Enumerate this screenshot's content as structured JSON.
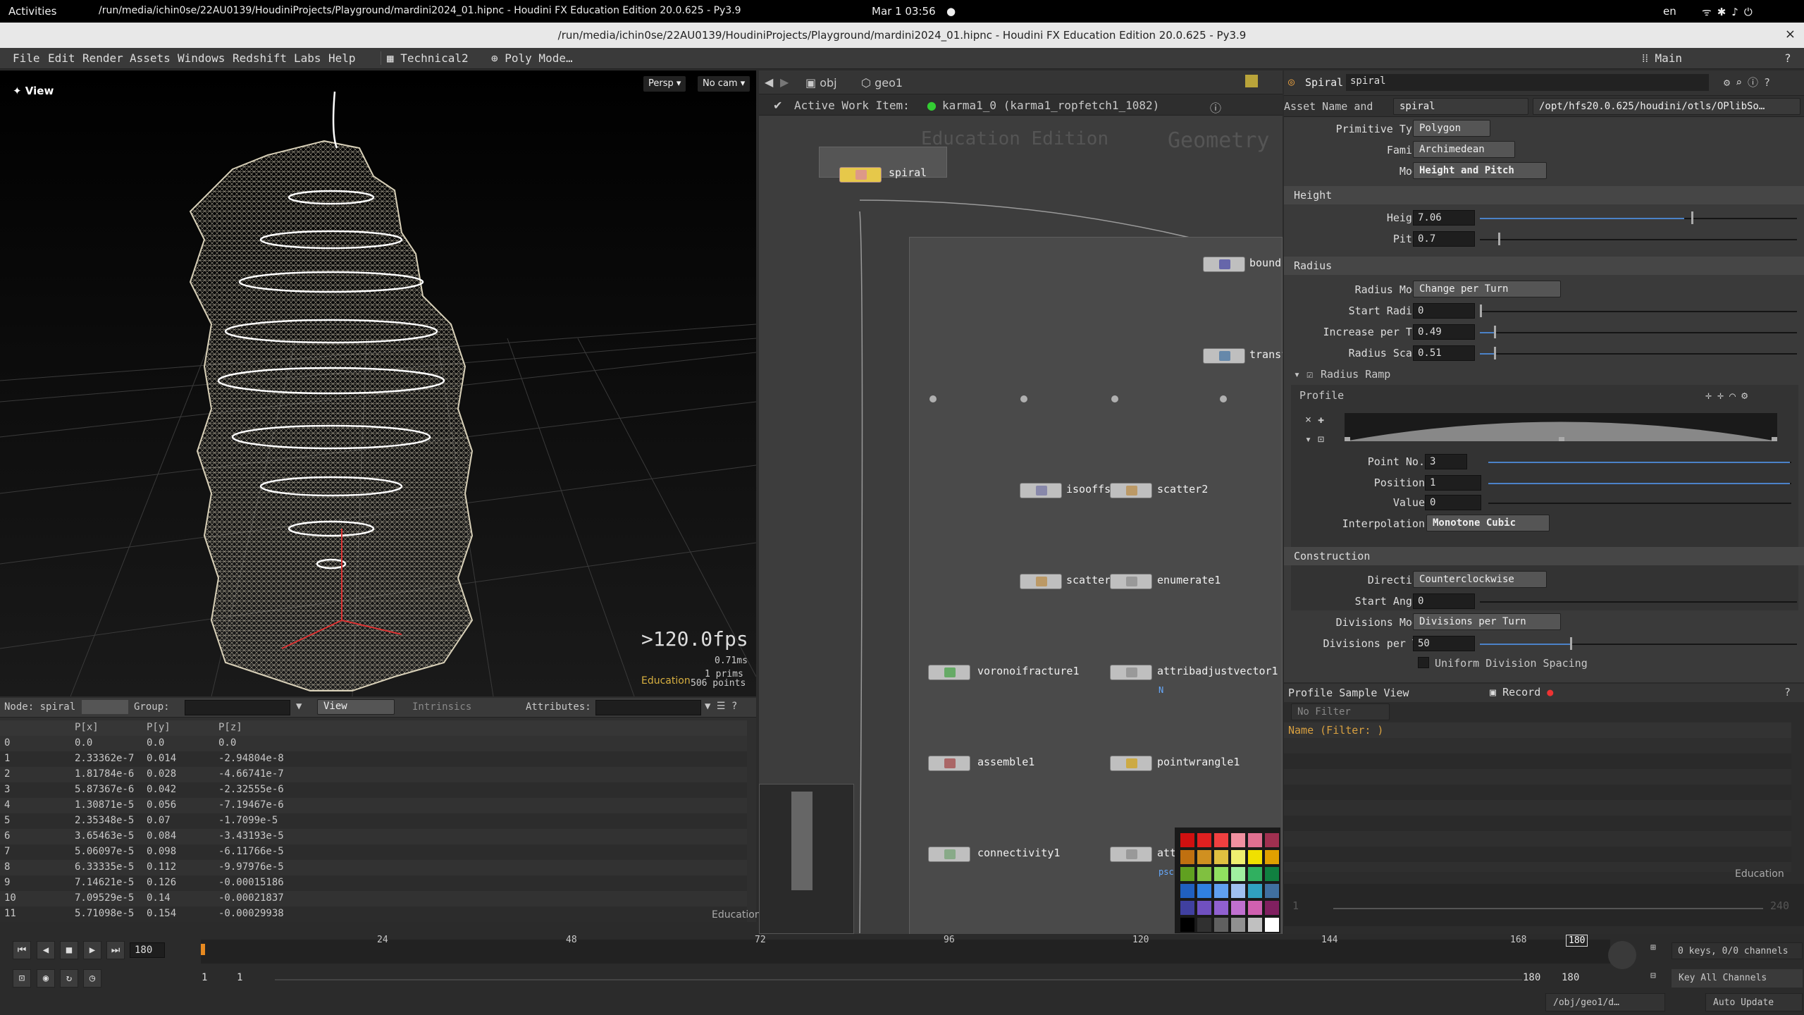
{
  "sysbar": {
    "activities": "Activities",
    "task": "/run/media/ichin0se/22AU0139/HoudiniProjects/Playground/mardini2024_01.hipnc - Houdini FX Education Edition 20.0.625 - Py3.9",
    "clock": "Mar 1  03:56",
    "lang": "en"
  },
  "window": {
    "title": "/run/media/ichin0se/22AU0139/HoudiniProjects/Playground/mardini2024_01.hipnc - Houdini FX Education Edition 20.0.625 - Py3.9",
    "close": "×"
  },
  "menubar": {
    "items": [
      "File",
      "Edit",
      "Render",
      "Assets",
      "Windows",
      "Redshift",
      "Labs",
      "Help"
    ],
    "desktop": "Technical2",
    "mode": "Poly Mode…",
    "pane": "Main"
  },
  "viewport": {
    "label": "View",
    "persp": "Persp ▾",
    "cam": "No cam ▾",
    "fps": ">120.0fps",
    "ms": "0.71ms",
    "prims": "1  prims",
    "points": "506 points",
    "edu": "Education"
  },
  "spreadsheet": {
    "node_label": "Node: spiral",
    "group_label": "Group:",
    "view": "View",
    "intrinsics": "Intrinsics",
    "attributes": "Attributes:",
    "edu": "Education",
    "columns": [
      "",
      "P[x]",
      "P[y]",
      "P[z]"
    ],
    "rows": [
      [
        "0",
        "0.0",
        "0.0",
        "0.0"
      ],
      [
        "1",
        "2.33362e-7",
        "0.014",
        "-2.94804e-8"
      ],
      [
        "2",
        "1.81784e-6",
        "0.028",
        "-4.66741e-7"
      ],
      [
        "3",
        "5.87367e-6",
        "0.042",
        "-2.32555e-6"
      ],
      [
        "4",
        "1.30871e-5",
        "0.056",
        "-7.19467e-6"
      ],
      [
        "5",
        "2.35348e-5",
        "0.07",
        "-1.7099e-5"
      ],
      [
        "6",
        "3.65463e-5",
        "0.084",
        "-3.43193e-5"
      ],
      [
        "7",
        "5.06097e-5",
        "0.098",
        "-6.11766e-5"
      ],
      [
        "8",
        "6.33335e-5",
        "0.112",
        "-9.97976e-5"
      ],
      [
        "9",
        "7.14621e-5",
        "0.126",
        "-0.00015186"
      ],
      [
        "10",
        "7.09529e-5",
        "0.14",
        "-0.00021837"
      ],
      [
        "11",
        "5.71098e-5",
        "0.154",
        "-0.00029938"
      ]
    ]
  },
  "network": {
    "path_obj": "obj",
    "path_geo": "geo1",
    "work_item_label": "Active Work Item:",
    "work_item": "karma1_0 (karma1_ropfetch1_1082)",
    "watermark1": "Education Edition",
    "watermark2": "Geometry",
    "nodes": {
      "spiral": "spiral",
      "bound": "bound:",
      "transf": "transf",
      "isooffs": "isooffs",
      "scatter2": "scatter2",
      "scatter": "scatter",
      "enumerate1": "enumerate1",
      "voronoifracture1": "voronoifracture1",
      "attribadjustvector1": "attribadjustvector1",
      "assemble1": "assemble1",
      "pointwrangle1": "pointwrangle1",
      "connectivity1": "connectivity1",
      "att": "att",
      "n_flag": "N",
      "psc": "psc"
    }
  },
  "params": {
    "node_type": "Spiral",
    "node_name": "spiral",
    "asset_label": "Asset Name and",
    "asset_name": "spiral",
    "asset_path": "/opt/hfs20.0.625/houdini/otls/OPlibSo…",
    "primitive_type_label": "Primitive Type",
    "primitive_type": "Polygon",
    "family_label": "Family",
    "family": "Archimedean",
    "mode_label": "Mode",
    "mode": "Height and Pitch",
    "height_section": "Height",
    "height_label": "Height",
    "height": "7.06",
    "pitch_label": "Pitch",
    "pitch": "0.7",
    "radius_section": "Radius",
    "radius_mode_label": "Radius Mode",
    "radius_mode": "Change per Turn",
    "start_radius_label": "Start Radius",
    "start_radius": "0",
    "increase_label": "Increase per Tu…",
    "increase": "0.49",
    "radius_scale_label": "Radius Scale",
    "radius_scale": "0.51",
    "ramp_label": "Radius Ramp",
    "profile_label": "Profile",
    "point_no_label": "Point No.",
    "point_no": "3",
    "position_label": "Position",
    "position": "1",
    "value_label": "Value",
    "value": "0",
    "interp_label": "Interpolation",
    "interp": "Monotone Cubic",
    "construction_section": "Construction",
    "direction_label": "Direction",
    "direction": "Counterclockwise",
    "start_angle_label": "Start Angle",
    "start_angle": "0",
    "div_mode_label": "Divisions Mode",
    "div_mode": "Divisions per Turn",
    "div_per_turn_label": "Divisions per T…",
    "div_per_turn": "50",
    "uniform_label": "Uniform Division Spacing"
  },
  "profile_pane": {
    "tab": "Profile Sample View",
    "record": "Record",
    "filter": "No Filter",
    "name_col": "Name  (Filter: )",
    "edu": "Education",
    "left_val": "1",
    "right_val": "240"
  },
  "timeline": {
    "frame": "180",
    "ticks": [
      "24",
      "48",
      "72",
      "96",
      "120",
      "144",
      "168"
    ],
    "end_marker": "180",
    "start1": "1",
    "start2": "1",
    "end1": "180",
    "end2": "180",
    "keys": "0 keys, 0/0 channels",
    "keyall": "Key All Channels",
    "path": "/obj/geo1/d…",
    "auto": "Auto Update"
  },
  "colors": {
    "accent": "#4b82c8",
    "node_body": "#bfbfbf",
    "wireframe": "#d8d0b8"
  }
}
